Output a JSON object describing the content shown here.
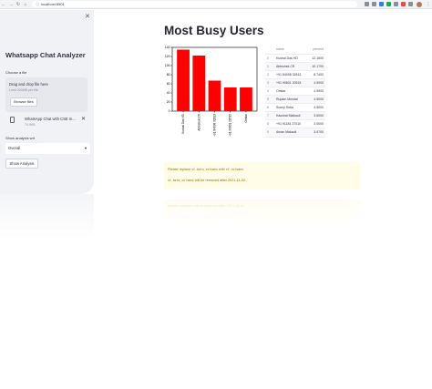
{
  "browser": {
    "url": "localhost:8501"
  },
  "sidebar": {
    "close_icon": "close-icon",
    "title": "Whatsapp Chat Analyzer",
    "choose_label": "Choose a file",
    "dropzone_text": "Drag and drop file here",
    "dropzone_limit": "Limit 200MB per file",
    "browse_label": "Browse files",
    "file_name": "WhatsApp Chat with CSE In...",
    "file_size": "74.9KB",
    "analysis_label": "Show analysis wrt",
    "analysis_value": "Overall",
    "show_button": "Show Analysis"
  },
  "main": {
    "title": "Most Busy Users",
    "table": {
      "headers": [
        "",
        "name",
        "percent"
      ],
      "rows": [
        [
          "0",
          "Kushal Das HD",
          "12.1600"
        ],
        [
          "1",
          "Abhishek CR",
          "10.1700"
        ],
        [
          "2",
          "+91 84098 32813",
          "8.7400"
        ],
        [
          "3",
          "+91 90601 20515",
          "4.5900"
        ],
        [
          "4",
          "Omkar",
          "4.5900"
        ],
        [
          "5",
          "Rupam Mondal",
          "4.5000"
        ],
        [
          "6",
          "Sunny Sirka",
          "4.5000"
        ],
        [
          "7",
          "Kaushal Malkauli",
          "3.6000"
        ],
        [
          "8",
          "+91 91184 37010",
          "3.0000"
        ],
        [
          "9",
          "Aman Makauli",
          "3.9700"
        ]
      ]
    },
    "warning": {
      "line1_pre": "Please replace",
      "line1_code1": "st.beta_columns",
      "line1_mid": "with",
      "line1_code2": "st.columns",
      "line2_code": "st.beta_columns",
      "line2_post": "will be removed after 2021-11-02.",
      "reflection": "st.beta_columns will be removed after 2021-11-02."
    }
  },
  "chart_data": {
    "type": "bar",
    "categories": [
      "Kushal Das HD",
      "Abhishek CR",
      "+91 84098 32813",
      "+91 90601 20515",
      "Omkar"
    ],
    "values": [
      135,
      122,
      67,
      52,
      52
    ],
    "ylim": [
      0,
      140
    ],
    "yticks": [
      0,
      20,
      40,
      60,
      80,
      100,
      120,
      140
    ],
    "bar_color": "#ff0000"
  },
  "colors": {
    "sidebar_bg": "#f0f2f6",
    "warning_bg": "#fffce7",
    "warning_text": "#926c05"
  }
}
